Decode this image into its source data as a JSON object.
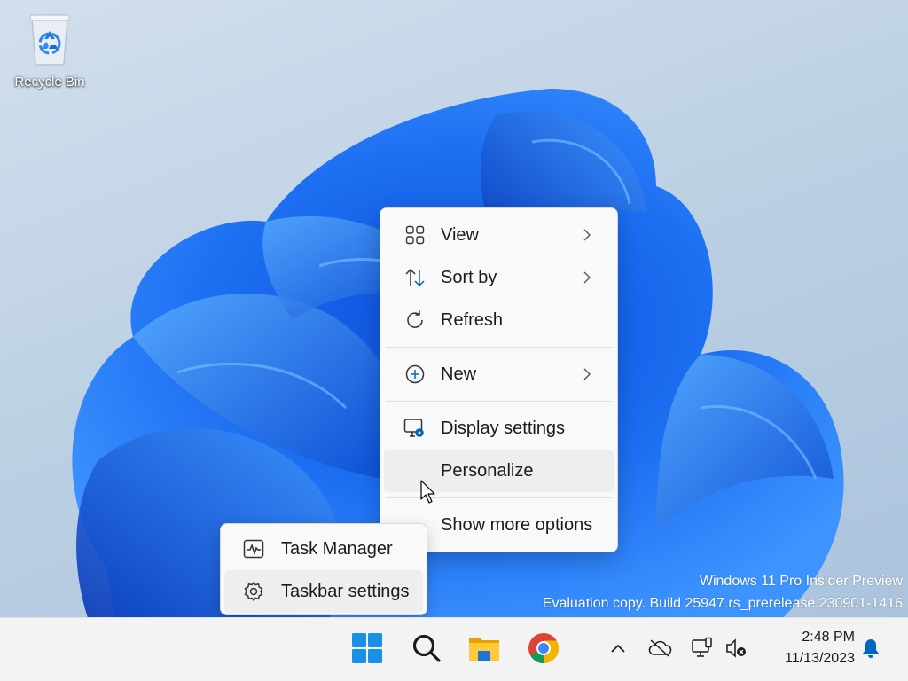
{
  "desktop": {
    "icons": [
      {
        "label": "Recycle Bin"
      }
    ],
    "watermark": {
      "line1": "Windows 11 Pro Insider Preview",
      "line2": "Evaluation copy. Build 25947.rs_prerelease.230901-1416"
    }
  },
  "context_menu": {
    "groups": [
      [
        {
          "label": "View",
          "icon": "grid-icon",
          "submenu": true
        },
        {
          "label": "Sort by",
          "icon": "sort-icon",
          "submenu": true
        },
        {
          "label": "Refresh",
          "icon": "refresh-icon",
          "submenu": false
        }
      ],
      [
        {
          "label": "New",
          "icon": "plus-circle-icon",
          "submenu": true
        }
      ],
      [
        {
          "label": "Display settings",
          "icon": "display-settings-icon",
          "submenu": false
        },
        {
          "label": "Personalize",
          "icon": "",
          "submenu": false,
          "hovered": true
        }
      ],
      [
        {
          "label": "Show more options",
          "icon": "",
          "submenu": false
        }
      ]
    ]
  },
  "taskbar_menu": {
    "items": [
      {
        "label": "Task Manager",
        "icon": "task-manager-icon"
      },
      {
        "label": "Taskbar settings",
        "icon": "gear-icon"
      }
    ]
  },
  "taskbar": {
    "apps": [
      {
        "name": "Start",
        "icon": "windows-logo-icon"
      },
      {
        "name": "Search",
        "icon": "search-icon"
      },
      {
        "name": "File Explorer",
        "icon": "folder-icon"
      },
      {
        "name": "Google Chrome",
        "icon": "chrome-icon"
      }
    ],
    "tray": {
      "icons": [
        "chevron-up-icon",
        "cloud-offline-icon",
        "network-icon",
        "volume-muted-icon",
        "bell-icon"
      ],
      "time": "2:48 PM",
      "date": "11/13/2023"
    }
  },
  "colors": {
    "accent": "#0067c0",
    "menu_bg": "#f9f9f9",
    "taskbar_bg": "#f3f3f3"
  }
}
